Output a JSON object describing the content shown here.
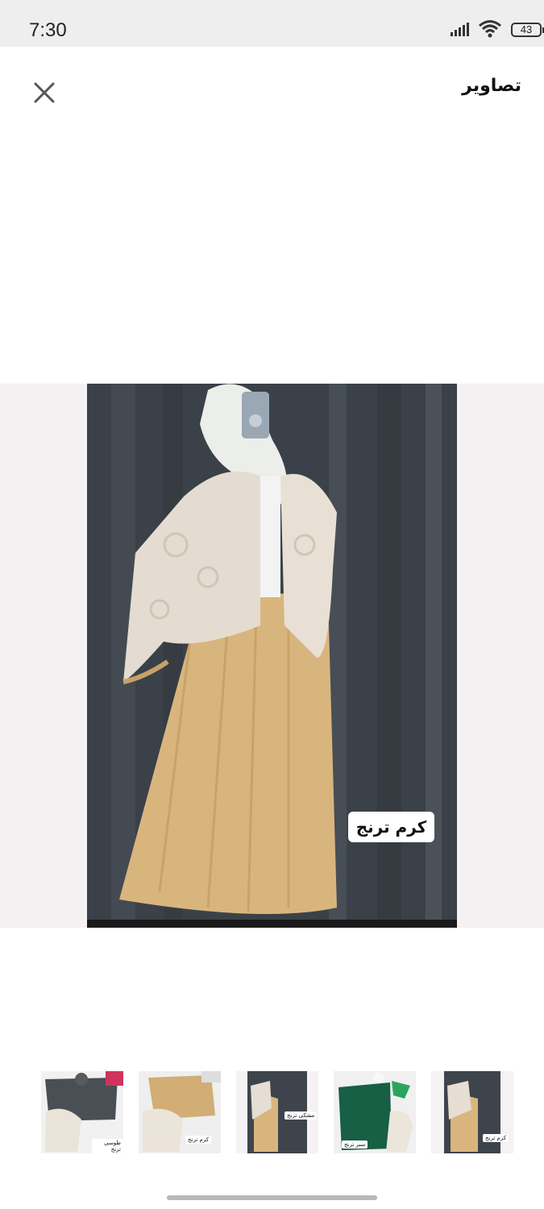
{
  "status_bar": {
    "time": "7:30",
    "battery": "43",
    "icons": [
      "signal-icon",
      "wifi-icon",
      "battery-icon"
    ]
  },
  "header": {
    "title": "تصاویر",
    "close_icon": "close-icon"
  },
  "viewer": {
    "caption": "کرم ترنج",
    "background_color": "#f4f1f3"
  },
  "thumbnails": [
    {
      "label": "طوسی ترنج",
      "selected": false
    },
    {
      "label": "کرم ترنج",
      "selected": false
    },
    {
      "label": "مشکی ترنج",
      "selected": false
    },
    {
      "label": "سبز ترنج",
      "selected": false
    },
    {
      "label": "کرم ترنج",
      "selected": false
    }
  ]
}
